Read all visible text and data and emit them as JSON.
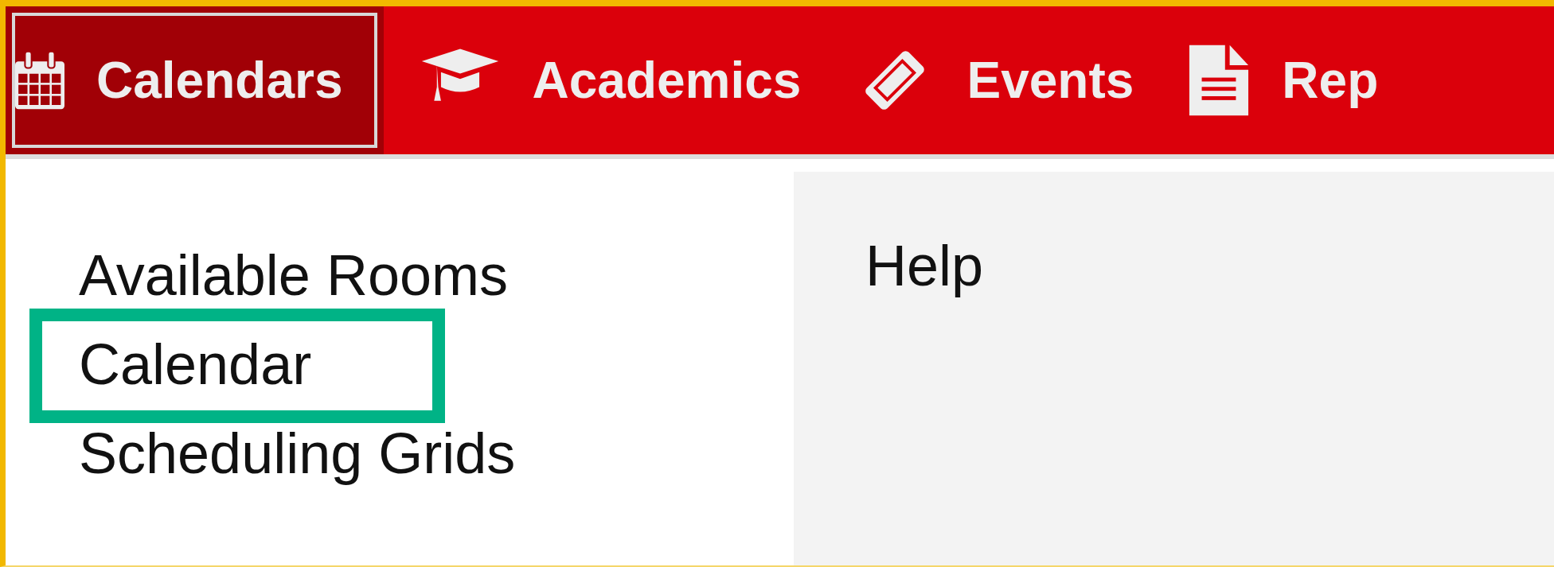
{
  "nav": {
    "tabs": [
      {
        "label": "Calendars",
        "kind": "calendar",
        "selected": true
      },
      {
        "label": "Academics",
        "kind": "cap",
        "selected": false
      },
      {
        "label": "Events",
        "kind": "ticket",
        "selected": false
      },
      {
        "label": "Rep",
        "kind": "document",
        "selected": false
      }
    ]
  },
  "menu": {
    "items": [
      {
        "label": "Available Rooms",
        "highlighted": false
      },
      {
        "label": "Calendar",
        "highlighted": true
      },
      {
        "label": "Scheduling Grids",
        "highlighted": false
      }
    ]
  },
  "side_panel": {
    "links": [
      "Help"
    ]
  }
}
